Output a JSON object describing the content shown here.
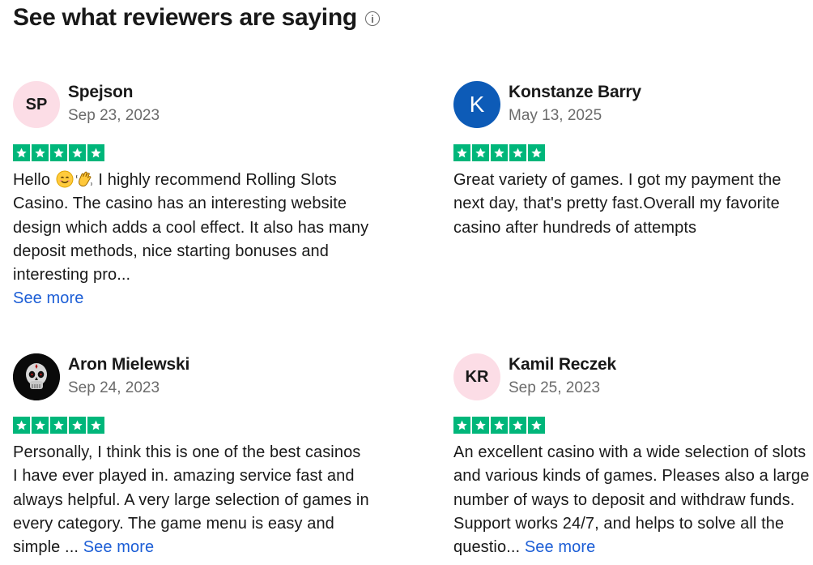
{
  "header": {
    "title": "See what reviewers are saying",
    "info_icon": "info-circle-icon"
  },
  "colors": {
    "star_green": "#00b67a",
    "link_blue": "#1c5ed6",
    "avatar_pink": "#fcdde6",
    "avatar_blue": "#0d5bb7",
    "muted_text": "#6b6b6b"
  },
  "reviews": [
    {
      "name": "Spejson",
      "initials": "SP",
      "date": "Sep 23, 2023",
      "rating": 5,
      "text_greeting": "Hello",
      "emojis": [
        "smiling-face-emoji",
        "waving-hand-emoji"
      ],
      "text_after_emoji": "I highly recommend Rolling Slots Casino. The casino has an interesting website design which adds a cool effect. It also has many deposit methods, nice starting bonuses and interesting pro...",
      "see_more": "See more"
    },
    {
      "name": "Konstanze Barry",
      "initials": "K",
      "date": "May 13, 2025",
      "rating": 5,
      "text": "Great variety of games. I got my payment the next day, that's pretty fast.Overall my favorite casino after hundreds of attempts"
    },
    {
      "name": "Aron Mielewski",
      "avatar_icon": "skull-avatar-icon",
      "date": "Sep 24, 2023",
      "rating": 5,
      "text": "Personally, I think this is one of the best casinos I have ever played in. amazing service fast and always helpful. A very large selection of games in every category. The game menu is easy and simple ...",
      "see_more": "See more"
    },
    {
      "name": "Kamil Reczek",
      "initials": "KR",
      "date": "Sep 25, 2023",
      "rating": 5,
      "text": "An excellent casino with a wide selection of slots and various kinds of games. Pleases also a large number of ways to deposit and withdraw funds. Support works 24/7, and helps to solve all the questio...",
      "see_more": "See more"
    }
  ]
}
